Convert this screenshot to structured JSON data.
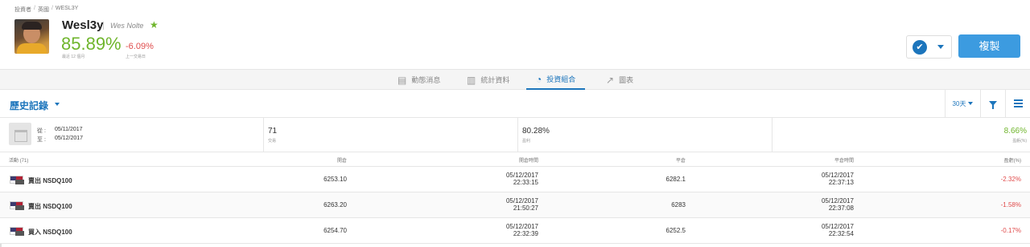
{
  "breadcrumb": [
    "投資者",
    "英國",
    "WESL3Y"
  ],
  "profile": {
    "username": "Wesl3y",
    "real_name": "Wes Nolte",
    "gain": "85.89%",
    "gain_label": "最近 12 個月",
    "daily": "-6.09%",
    "daily_label": "上一交易日"
  },
  "actions": {
    "copy_label": "複製",
    "check_glyph": "✔",
    "star_glyph": "★"
  },
  "tabs": [
    {
      "label": "動態消息",
      "icon": "newsfeed-icon",
      "glyph": "▤"
    },
    {
      "label": "統計資料",
      "icon": "stats-icon",
      "glyph": "▥"
    },
    {
      "label": "投資組合",
      "icon": "portfolio-pie-icon",
      "glyph": "◔"
    },
    {
      "label": "圖表",
      "icon": "chart-icon",
      "glyph": "↗"
    }
  ],
  "history": {
    "title": "歷史記錄",
    "period": "30天"
  },
  "summary": {
    "from_label": "從 :",
    "to_label": "至 :",
    "from_date": "05/11/2017",
    "to_date": "05/12/2017",
    "trades": "71",
    "trades_label": "交易",
    "profitable": "80.28%",
    "profitable_label": "盈利",
    "gain": "8.66%",
    "gain_label": "盈虧(%)"
  },
  "columns": [
    "活動 (71)",
    "開倉",
    "開倉時間",
    "平倉",
    "平倉時間",
    "盈虧(%)"
  ],
  "rows": [
    {
      "action": "賣出 NSDQ100",
      "open": "6253.10",
      "open_date": "05/12/2017",
      "open_time": "22:33:15",
      "close": "6282.1",
      "close_date": "05/12/2017",
      "close_time": "22:37:13",
      "pl": "-2.32%"
    },
    {
      "action": "賣出 NSDQ100",
      "open": "6263.20",
      "open_date": "05/12/2017",
      "open_time": "21:50:27",
      "close": "6283",
      "close_date": "05/12/2017",
      "close_time": "22:37:08",
      "pl": "-1.58%"
    },
    {
      "action": "買入 NSDQ100",
      "open": "6254.70",
      "open_date": "05/12/2017",
      "open_time": "22:32:39",
      "close": "6252.5",
      "close_date": "05/12/2017",
      "close_time": "22:32:54",
      "pl": "-0.17%"
    }
  ],
  "colors": {
    "accent": "#1c75bc",
    "gain": "#6fb52c",
    "loss": "#e04b4b",
    "copy_button": "#3c9be0"
  }
}
